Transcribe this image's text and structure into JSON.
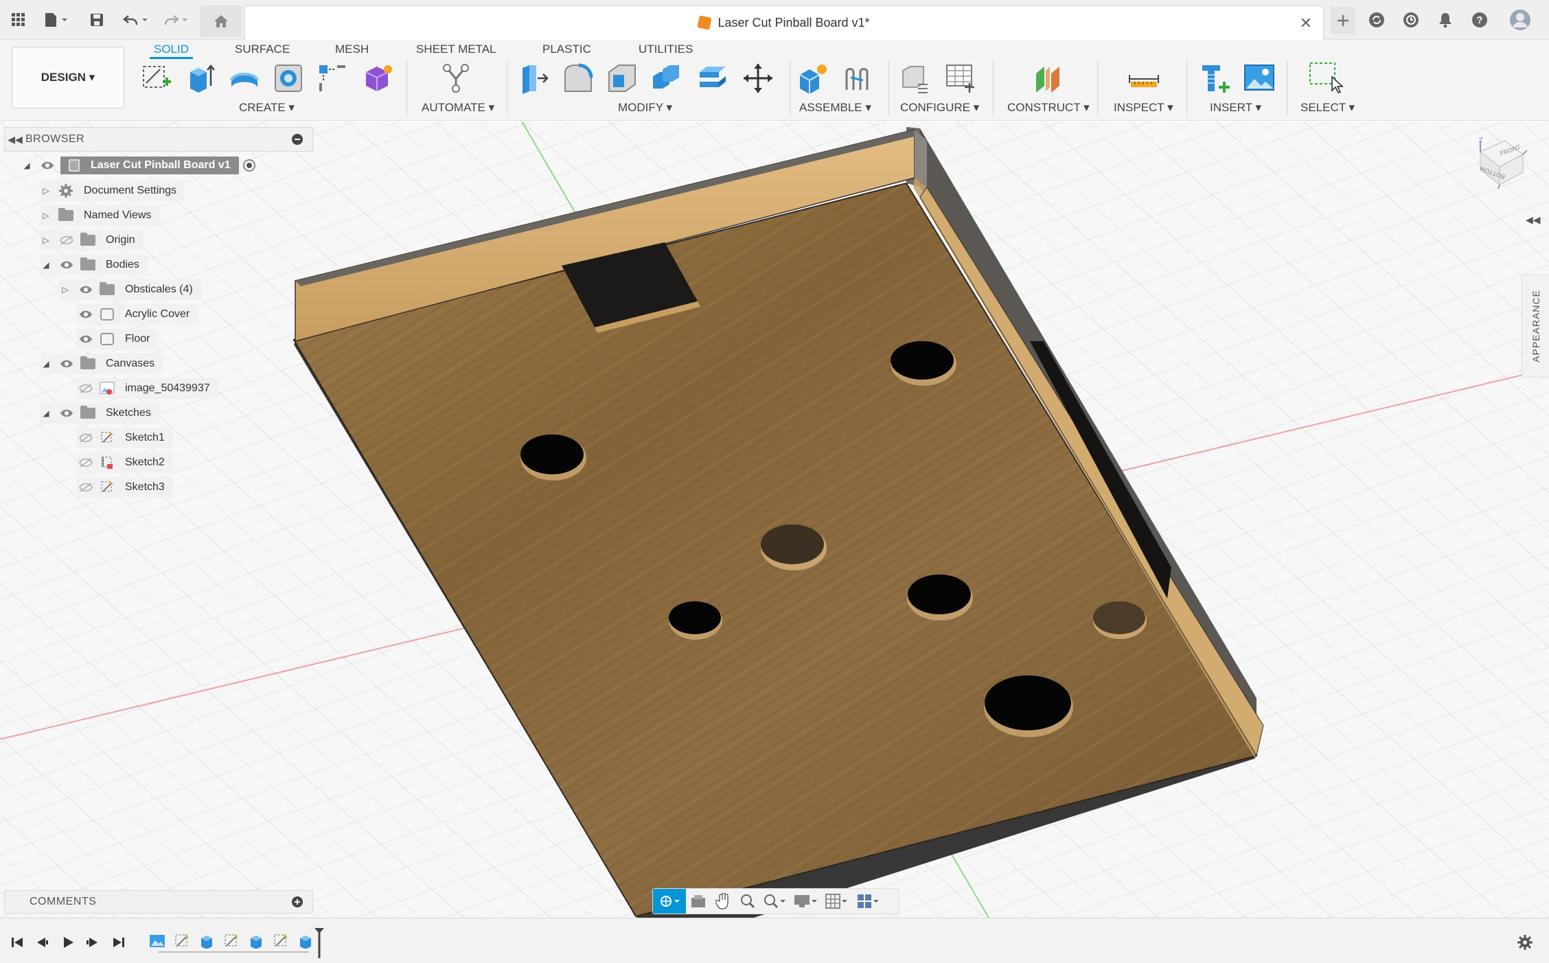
{
  "window": {
    "document_title": "Laser Cut Pinball Board v1*"
  },
  "ribbon": {
    "workspace_button": "DESIGN ▾",
    "tabs": [
      "SOLID",
      "SURFACE",
      "MESH",
      "SHEET METAL",
      "PLASTIC",
      "UTILITIES"
    ],
    "active_tab": "SOLID",
    "groups": {
      "create": "CREATE ▾",
      "automate": "AUTOMATE ▾",
      "modify": "MODIFY ▾",
      "assemble": "ASSEMBLE ▾",
      "configure": "CONFIGURE ▾",
      "construct": "CONSTRUCT ▾",
      "inspect": "INSPECT ▾",
      "insert": "INSERT ▾",
      "select": "SELECT ▾"
    }
  },
  "browser": {
    "title": "BROWSER",
    "root": "Laser Cut Pinball Board v1",
    "items": [
      {
        "label": "Document Settings",
        "icon": "gear-icon"
      },
      {
        "label": "Named Views",
        "icon": "folder-icon"
      },
      {
        "label": "Origin",
        "icon": "folder-icon",
        "visible": false
      },
      {
        "label": "Bodies",
        "icon": "folder-icon",
        "visible": true
      },
      {
        "label": "Obsticales (4)",
        "icon": "folder-icon",
        "visible": true
      },
      {
        "label": "Acrylic Cover",
        "icon": "body-icon",
        "visible": true
      },
      {
        "label": "Floor",
        "icon": "body-icon",
        "visible": true
      },
      {
        "label": "Canvases",
        "icon": "folder-icon",
        "visible": true
      },
      {
        "label": "image_50439937",
        "icon": "canvas-image-icon",
        "visible": false
      },
      {
        "label": "Sketches",
        "icon": "folder-icon",
        "visible": true
      },
      {
        "label": "Sketch1",
        "icon": "sketch-icon",
        "visible": false
      },
      {
        "label": "Sketch2",
        "icon": "sketch-icon",
        "visible": false
      },
      {
        "label": "Sketch3",
        "icon": "sketch-icon",
        "visible": false
      }
    ]
  },
  "comments": {
    "title": "COMMENTS"
  },
  "viewcube": {
    "top_face": "FRONT",
    "side_face": "BOTTOM",
    "axis_label": "Z"
  },
  "appearance_panel": {
    "label": "APPEARANCE"
  },
  "colors": {
    "accent": "#0696d7",
    "wood": "#8a6a40",
    "wood_light": "#d7b27a",
    "edge": "#55524d"
  }
}
